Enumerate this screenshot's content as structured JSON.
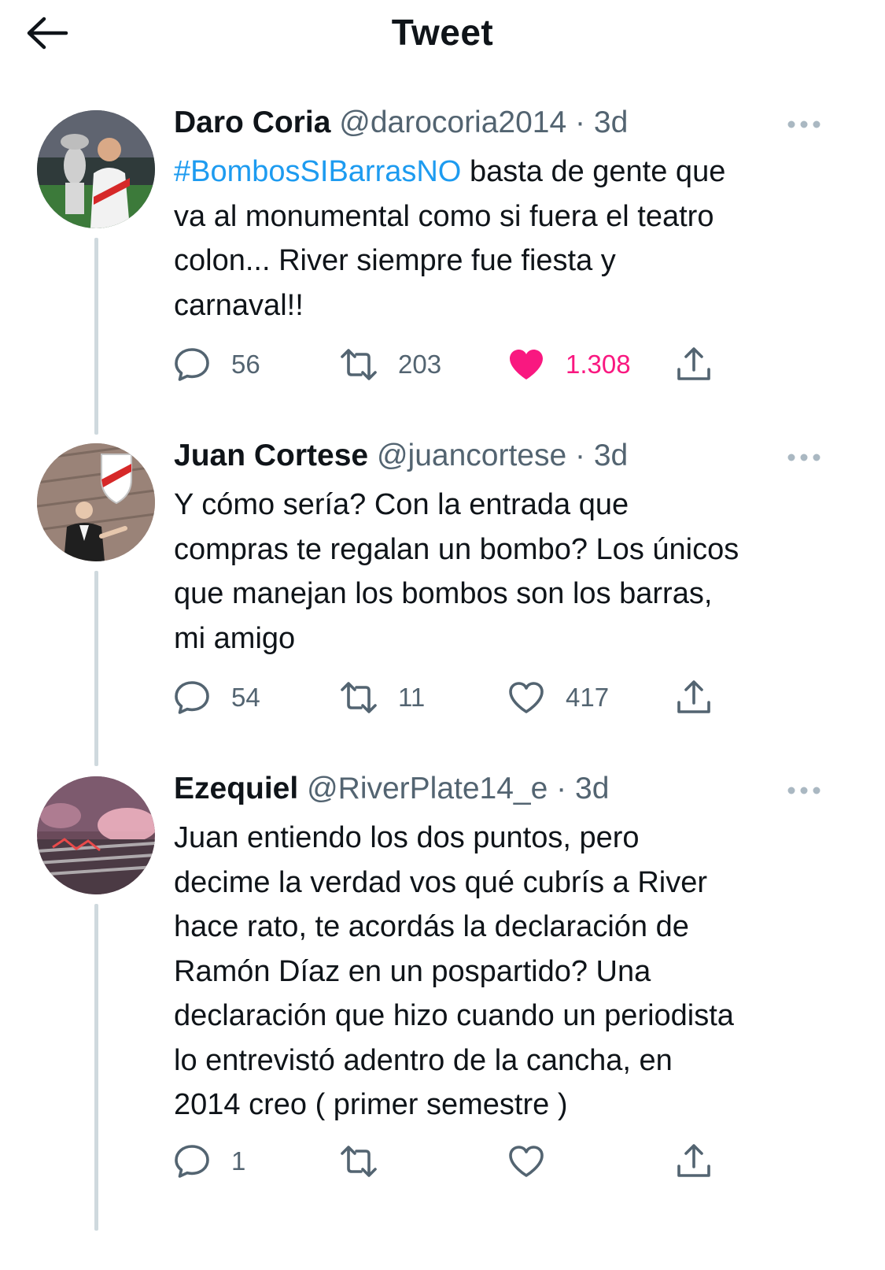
{
  "header": {
    "title": "Tweet",
    "back_icon": "arrow-left-icon"
  },
  "tweets": [
    {
      "name": "Daro Coria",
      "handle": "@darocoria2014",
      "sep": "·",
      "time": "3d",
      "hashtag": "#BombosSIBarrasNO",
      "lines": [
        "basta de gente que",
        "va al monumental como si fuera el teatro",
        "colon... River siempre fue fiesta y",
        "carnaval!!"
      ],
      "replies": "56",
      "retweets": "203",
      "likes": "1.308",
      "liked": true
    },
    {
      "name": "Juan Cortese",
      "handle": "@juancortese",
      "sep": "·",
      "time": "3d",
      "lines": [
        "Y cómo sería? Con la entrada que",
        "compras te regalan un bombo? Los únicos",
        "que manejan los bombos son los barras,",
        "mi amigo"
      ],
      "replies": "54",
      "retweets": "11",
      "likes": "417",
      "liked": false
    },
    {
      "name": "Ezequiel",
      "handle": "@RiverPlate14_e",
      "sep": "·",
      "time": "3d",
      "lines": [
        "Juan entiendo los dos puntos, pero",
        "decime la verdad vos qué cubrís a River",
        "hace rato, te acordás la declaración de",
        "Ramón Díaz en un pospartido? Una",
        "declaración que hizo cuando un periodista",
        "lo entrevistó adentro de la cancha, en",
        "2014 creo ( primer semestre )"
      ],
      "replies": "1",
      "retweets": "",
      "likes": "",
      "liked": false
    }
  ],
  "colors": {
    "accent": "#1d9bf0",
    "like": "#f91880",
    "muted": "#536471",
    "text": "#0f1419",
    "thread": "#cfd9de"
  }
}
